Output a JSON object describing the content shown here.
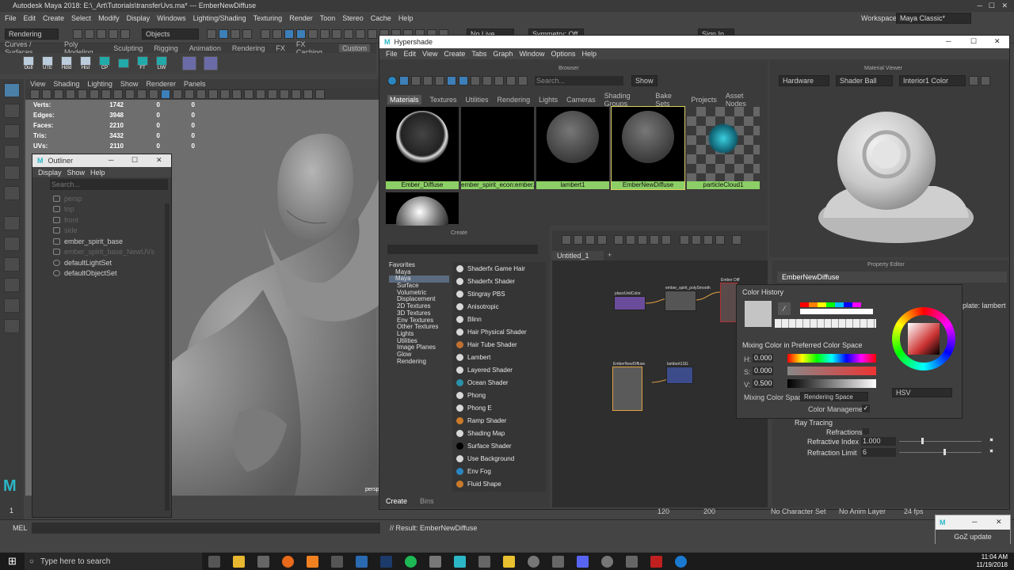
{
  "titlebar": {
    "title": "Autodesk Maya 2018: E:\\_Art\\Tutorials\\transferUvs.ma*   ---   EmberNewDiffuse"
  },
  "mainmenu": [
    "File",
    "Edit",
    "Create",
    "Select",
    "Modify",
    "Display",
    "Windows",
    "Lighting/Shading",
    "Texturing",
    "Render",
    "Toon",
    "Stereo",
    "Cache",
    "Help"
  ],
  "statusline": {
    "menuset": "Rendering",
    "selmode": "Objects",
    "workspace_label": "Workspace :",
    "workspace": "Maya Classic*",
    "live": "No Live Surface",
    "sym": "Symmetry: Off",
    "signin": "Sign In"
  },
  "shelftabs": [
    "Curves / Surfaces",
    "Poly Modeling",
    "Sculpting",
    "Rigging",
    "Animation",
    "Rendering",
    "FX",
    "FX Caching",
    "Custom"
  ],
  "shelf": [
    "Outl",
    "UTE",
    "Hdld",
    "Hist",
    "CP",
    "",
    "FT",
    "LtW"
  ],
  "viewport": {
    "menu": [
      "View",
      "Shading",
      "Lighting",
      "Show",
      "Renderer",
      "Panels"
    ],
    "hud": [
      [
        "Verts:",
        "1742",
        "0",
        "0"
      ],
      [
        "Edges:",
        "3948",
        "0",
        "0"
      ],
      [
        "Faces:",
        "2210",
        "0",
        "0"
      ],
      [
        "Tris:",
        "3432",
        "0",
        "0"
      ],
      [
        "UVs:",
        "2110",
        "0",
        "0"
      ]
    ],
    "camera": "persp"
  },
  "outliner": {
    "title": "Outliner",
    "menu": [
      "Display",
      "Show",
      "Help"
    ],
    "search": "Search...",
    "items": [
      {
        "label": "persp",
        "dim": true
      },
      {
        "label": "top",
        "dim": true
      },
      {
        "label": "front",
        "dim": true
      },
      {
        "label": "side",
        "dim": true
      },
      {
        "label": "ember_spirit_base",
        "dim": false
      },
      {
        "label": "ember_spirit_base_NewUVs",
        "dim": true
      },
      {
        "label": "defaultLightSet",
        "dim": false
      },
      {
        "label": "defaultObjectSet",
        "dim": false
      }
    ]
  },
  "hypershade": {
    "title": "Hypershade",
    "menu": [
      "File",
      "Edit",
      "View",
      "Create",
      "Tabs",
      "Graph",
      "Window",
      "Options",
      "Help"
    ],
    "browser_label": "Browser",
    "search": "Search...",
    "show": "Show",
    "tabs": [
      "Materials",
      "Textures",
      "Utilities",
      "Rendering",
      "Lights",
      "Cameras",
      "Shading Groups",
      "Bake Sets",
      "Projects",
      "Asset Nodes"
    ],
    "materials": [
      "Ember_Diffuse",
      "ember_spirit_econ:ember...",
      "lambert1",
      "EmberNewDiffuse",
      "particleCloud1"
    ],
    "create_label": "Create",
    "categories": [
      "Favorites",
      "Maya",
      "Surface",
      "Volumetric",
      "Displacement",
      "2D Textures",
      "3D Textures",
      "Env Textures",
      "Other Textures",
      "Lights",
      "Utilities",
      "Image Planes",
      "Glow",
      "Rendering"
    ],
    "nodes": [
      "Shaderfx Game Hair",
      "Shaderfx Shader",
      "Stingray PBS",
      "Anisotropic",
      "Blinn",
      "Hair Physical Shader",
      "Hair Tube Shader",
      "Lambert",
      "Layered Shader",
      "Ocean Shader",
      "Phong",
      "Phong E",
      "Ramp Shader",
      "Shading Map",
      "Surface Shader",
      "Use Background",
      "Env Fog",
      "Fluid Shape"
    ],
    "bottom_tabs": [
      "Create",
      "Bins"
    ],
    "graph_tab": "Untitled_1",
    "graph_nodes": [
      "placeUnitColor",
      "ember_spirit_polySmooth",
      "Ember Diff",
      "EmberNewDiffuse",
      "lambert1SG"
    ],
    "matviewer": {
      "label": "Material Viewer",
      "renderer": "Hardware",
      "geometry": "Shader Ball",
      "env": "Interior1 Color"
    },
    "property": {
      "label": "Property Editor",
      "name": "EmberNewDiffuse",
      "template": "plate: lambert",
      "refractions": "Refractions",
      "ray_tracing": "Ray Tracing",
      "ri_label": "Refractive Index",
      "ri_val": "1.000",
      "rl_label": "Refraction Limit",
      "rl_val": "6"
    }
  },
  "colorhistory": {
    "title": "Color History",
    "mix_label": "Mixing Color in Preferred Color Space",
    "h_label": "H:",
    "h_val": "0.000",
    "s_label": "S:",
    "s_val": "0.000",
    "v_label": "V:",
    "v_val": "0.500",
    "space_label": "Mixing Color Space:",
    "space": "Rendering Space",
    "mgmt_label": "Color Management",
    "mode": "HSV",
    "swatches": [
      "#ff0000",
      "#ff8000",
      "#ffff00",
      "#00ff00",
      "#00c0ff",
      "#0000ff",
      "#ff00ff",
      "#ffffff",
      "#ffffff",
      "#ffffff",
      "#ffffff",
      "#ffffff",
      "#ffffff",
      "#ffffff"
    ]
  },
  "bottom": {
    "mel": "MEL",
    "result": "// Result: EmberNewDiffuse",
    "frame": "1",
    "t120": "120",
    "t200": "200",
    "char": "No Character Set",
    "anim": "No Anim Layer",
    "fps": "24 fps"
  },
  "goz": {
    "label": "GoZ update"
  },
  "taskbar": {
    "search": "Type here to search",
    "time": "11:04 AM",
    "date": "11/19/2018"
  }
}
